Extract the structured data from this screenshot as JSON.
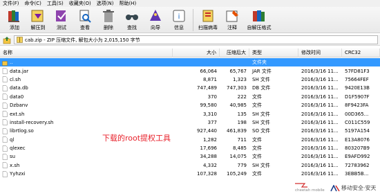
{
  "menu": [
    "文件(F)",
    "命令(C)",
    "工具(S)",
    "收藏夹(O)",
    "选项(N)",
    "帮助(H)"
  ],
  "toolbar": [
    {
      "label": "添加",
      "icon": "books-add-icon"
    },
    {
      "label": "解压到",
      "icon": "extract-to-icon"
    },
    {
      "label": "测试",
      "icon": "test-icon"
    },
    {
      "label": "查看",
      "icon": "view-icon"
    },
    {
      "label": "删除",
      "icon": "delete-icon"
    },
    {
      "label": "查找",
      "icon": "find-icon"
    },
    {
      "label": "向导",
      "icon": "wizard-icon"
    },
    {
      "label": "信息",
      "icon": "info-icon"
    },
    {
      "label": "扫描病毒",
      "icon": "virus-scan-icon"
    },
    {
      "label": "注释",
      "icon": "comment-icon"
    },
    {
      "label": "自解压格式",
      "icon": "sfx-icon"
    }
  ],
  "address": "cab.zip - ZIP 压缩文件, 解包大小为 2,015,150 字节",
  "columns": [
    "名称",
    "大小",
    "压缩后大小",
    "类型",
    "修改时间",
    "CRC32"
  ],
  "rows": [
    {
      "name": "..",
      "size": "",
      "packed": "",
      "type": "文件夹",
      "modified": "",
      "crc": "",
      "icon": "folder-up-icon",
      "selected": true
    },
    {
      "name": "data.jar",
      "size": "66,064",
      "packed": "65,767",
      "type": "JAR 文件",
      "modified": "2016/3/16 11...",
      "crc": "57FD81F3",
      "icon": "file-icon"
    },
    {
      "name": "cl.sh",
      "size": "8,871",
      "packed": "1,323",
      "type": "SH 文件",
      "modified": "2016/3/16 11...",
      "crc": "75664FEF",
      "icon": "file-icon"
    },
    {
      "name": "data.db",
      "size": "747,489",
      "packed": "747,303",
      "type": "DB 文件",
      "modified": "2016/3/16 11...",
      "crc": "9420E13B",
      "icon": "file-icon"
    },
    {
      "name": "data0",
      "size": "370",
      "packed": "222",
      "type": "文件",
      "modified": "2016/3/16 11...",
      "crc": "D1F5907F",
      "icon": "file-icon"
    },
    {
      "name": "Dzbanv",
      "size": "99,580",
      "packed": "40,985",
      "type": "文件",
      "modified": "2016/3/16 11...",
      "crc": "8F9423FA",
      "icon": "file-icon"
    },
    {
      "name": "ext.sh",
      "size": "3,310",
      "packed": "135",
      "type": "SH 文件",
      "modified": "2016/3/16 11...",
      "crc": "00D365...",
      "icon": "file-icon"
    },
    {
      "name": "install-recovery.sh",
      "size": "377",
      "packed": "198",
      "type": "SH 文件",
      "modified": "2016/3/16 11...",
      "crc": "C011C559",
      "icon": "file-icon"
    },
    {
      "name": "librtlog.so",
      "size": "927,440",
      "packed": "461,839",
      "type": "SO 文件",
      "modified": "2016/3/16 11...",
      "crc": "5197A154",
      "icon": "file-icon"
    },
    {
      "name": "ql",
      "size": "1,282",
      "packed": "711",
      "type": "文件",
      "modified": "2016/3/16 11...",
      "crc": "E13A8076",
      "icon": "file-icon"
    },
    {
      "name": "qlexec",
      "size": "17,696",
      "packed": "8,485",
      "type": "文件",
      "modified": "2016/3/16 11...",
      "crc": "803207B9",
      "icon": "file-icon"
    },
    {
      "name": "su",
      "size": "34,288",
      "packed": "14,075",
      "type": "文件",
      "modified": "2016/3/16 11...",
      "crc": "E9AFD992",
      "icon": "file-icon"
    },
    {
      "name": "x.sh",
      "size": "4,332",
      "packed": "779",
      "type": "SH 文件",
      "modified": "2016/3/16 11...",
      "crc": "72783962",
      "icon": "file-icon"
    },
    {
      "name": "Yyhzxi",
      "size": "107,328",
      "packed": "105,249",
      "type": "文件",
      "modified": "2016/3/16 11...",
      "crc": "3EBB5B...",
      "icon": "file-icon"
    }
  ],
  "annotation": "下载的root提权工具",
  "watermark_left": "cheetah mobile",
  "watermark_right": "移动安全·安天",
  "colors": {
    "selection": "#3399ff",
    "annotation": "#e8212b"
  }
}
